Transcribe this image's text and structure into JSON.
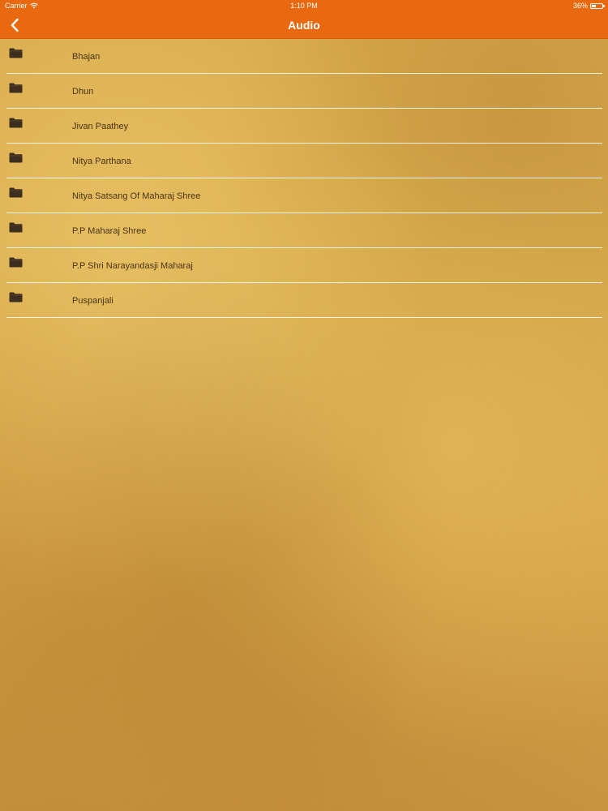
{
  "status_bar": {
    "carrier": "Carrier",
    "time": "1:10 PM",
    "battery": "36%",
    "battery_level": 0.36
  },
  "nav": {
    "title": "Audio",
    "back_icon": "chevron-left-icon"
  },
  "colors": {
    "accent": "#e8690f",
    "text": "#4a3416",
    "divider": "#ffffff"
  },
  "list": {
    "items": [
      {
        "label": "Bhajan",
        "icon": "folder-icon"
      },
      {
        "label": "Dhun",
        "icon": "folder-icon"
      },
      {
        "label": "Jivan Paathey",
        "icon": "folder-icon"
      },
      {
        "label": "Nitya Parthana",
        "icon": "folder-icon"
      },
      {
        "label": "Nitya Satsang Of Maharaj Shree",
        "icon": "folder-icon"
      },
      {
        "label": "P.P Maharaj Shree",
        "icon": "folder-icon"
      },
      {
        "label": "P.P Shri Narayandasji Maharaj",
        "icon": "folder-icon"
      },
      {
        "label": "Puspanjali",
        "icon": "folder-icon"
      }
    ]
  }
}
